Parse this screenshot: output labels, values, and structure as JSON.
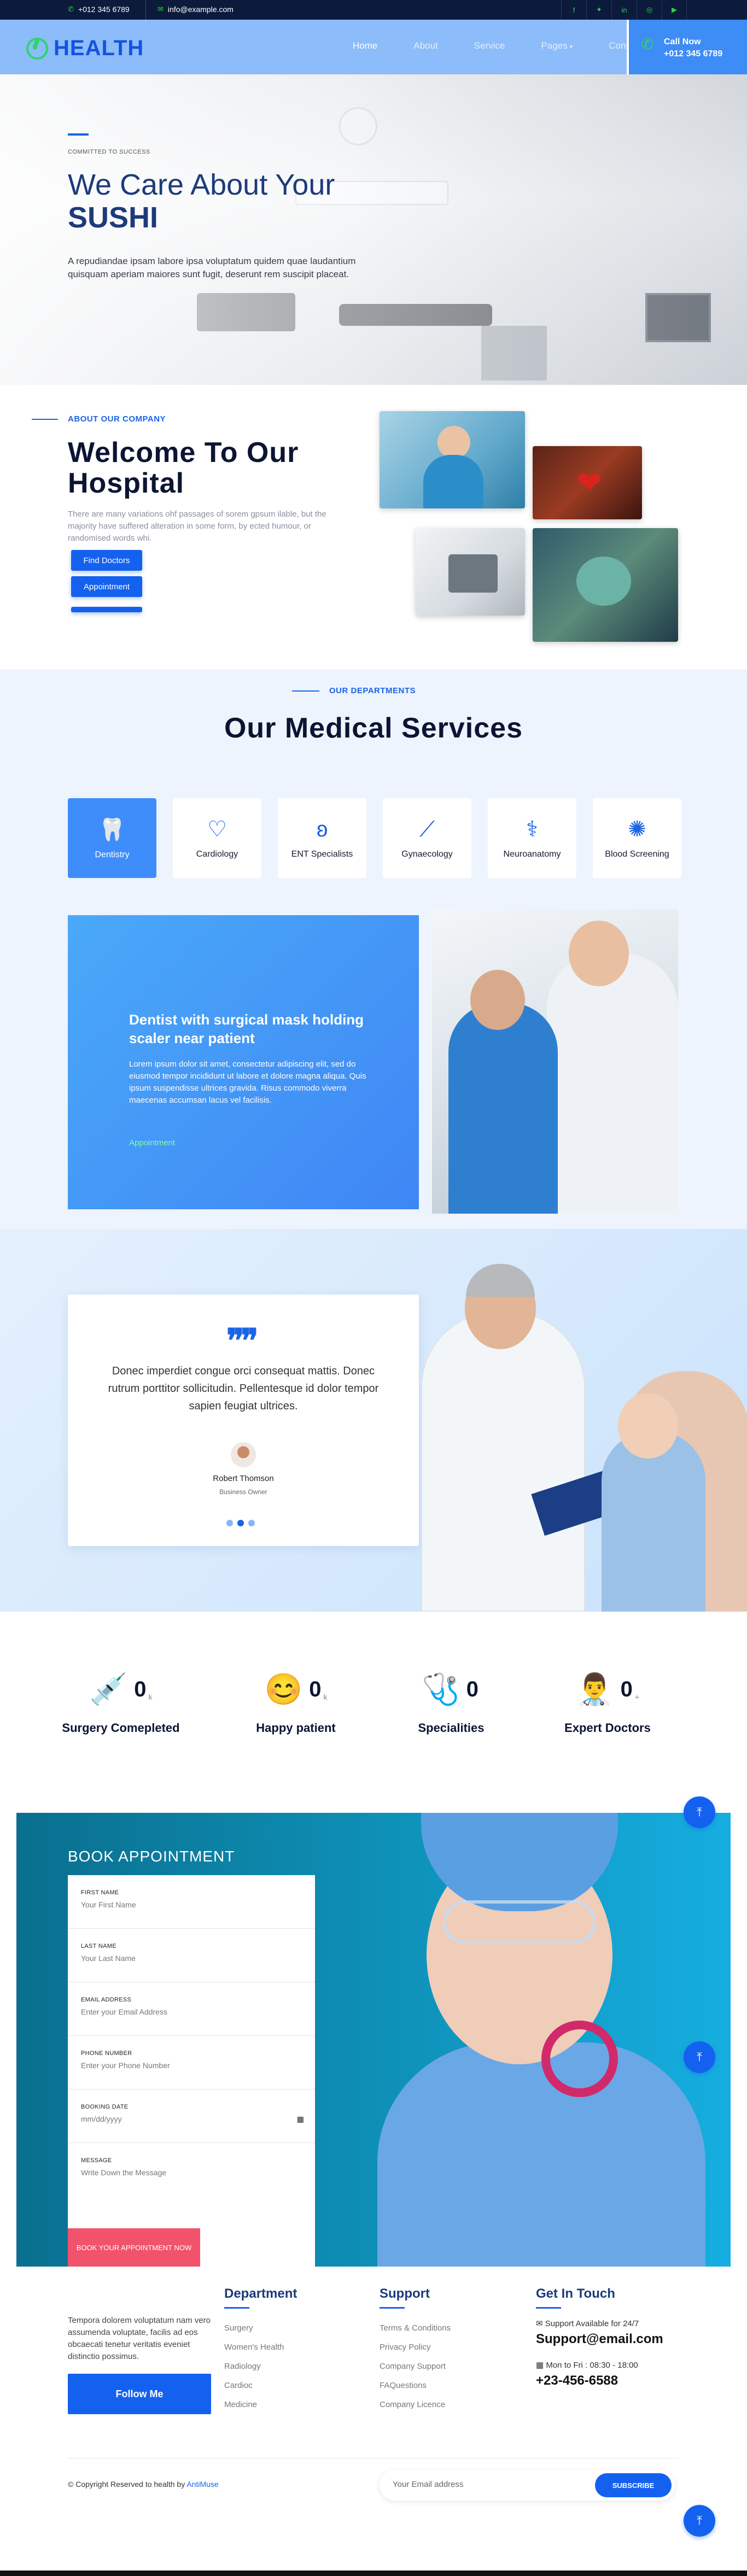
{
  "topbar": {
    "phone": "+012 345 6789",
    "email": "info@example.com",
    "social_icons": [
      "facebook-icon",
      "twitter-icon",
      "linkedin-icon",
      "instagram-icon",
      "youtube-icon"
    ]
  },
  "navbar": {
    "brand": "HEALTH",
    "links": [
      "Home",
      "About",
      "Service",
      "Pages",
      "Contact"
    ],
    "active": "Home",
    "call_label": "Call Now",
    "call_number": "+012 345 6789"
  },
  "hero": {
    "kicker": "COMMITTED TO SUCCESS",
    "title": "We Care About Your",
    "title_bold": "SUSHI",
    "description": "A repudiandae ipsam labore ipsa voluptatum quidem quae laudantium quisquam aperiam maiores sunt fugit, deserunt rem suscipit placeat."
  },
  "about": {
    "kicker": "ABOUT OUR COMPANY",
    "title": "Welcome To Our Hospital",
    "text": "There are many variations ohf passages of sorem gpsum ilable, but the majority have suffered alteration in some form, by ected humour, or randomised words whi.",
    "find_doctors": "Find Doctors",
    "appointment": "Appointment"
  },
  "services": {
    "kicker": "OUR DEPARTMENTS",
    "title": "Our Medical Services",
    "tabs": [
      {
        "label": "Dentistry",
        "icon": "tooth-icon"
      },
      {
        "label": "Cardiology",
        "icon": "heart-icon"
      },
      {
        "label": "ENT Specialists",
        "icon": "ear-icon"
      },
      {
        "label": "Gynaecology",
        "icon": "syringe-icon"
      },
      {
        "label": "Neuroanatomy",
        "icon": "lungs-icon"
      },
      {
        "label": "Blood Screening",
        "icon": "virus-icon"
      }
    ],
    "active_tab": "Dentistry",
    "card_title": "Dentist with surgical mask holding scaler near patient",
    "card_text": "Lorem ipsum dolor sit amet, consectetur adipiscing elit, sed do eiusmod tempor incididunt ut labore et dolore magna aliqua. Quis ipsum suspendisse ultrices gravida. Risus commodo viverra maecenas accumsan lacus vel facilisis.",
    "card_link": "Appointment"
  },
  "testimonial": {
    "quote": "Donec imperdiet congue orci consequat mattis. Donec rutrum porttitor sollicitudin. Pellentesque id dolor tempor sapien feugiat ultrices.",
    "name": "Robert Thomson",
    "role": "Business Owner",
    "slides": 3,
    "active_slide": 2
  },
  "counters": [
    {
      "value": "0",
      "unit": "k",
      "label": "Surgery Comepleted",
      "icon": "drip-icon"
    },
    {
      "value": "0",
      "unit": "k",
      "label": "Happy patient",
      "icon": "happy-face-icon"
    },
    {
      "value": "0",
      "unit": "",
      "label": "Specialities",
      "icon": "stethoscope-icon"
    },
    {
      "value": "0",
      "unit": "+",
      "label": "Expert Doctors",
      "icon": "doctor-icon"
    }
  ],
  "booking": {
    "title": "BOOK APPOINTMENT",
    "fields": [
      {
        "label": "FIRST NAME",
        "placeholder": "Your First Name"
      },
      {
        "label": "LAST NAME",
        "placeholder": "Your Last Name"
      },
      {
        "label": "EMAIL ADDRESS",
        "placeholder": "Enter your Email Address"
      },
      {
        "label": "PHONE NUMBER",
        "placeholder": "Enter your Phone Number"
      },
      {
        "label": "BOOKING DATE",
        "placeholder": "mm/dd/yyyy"
      },
      {
        "label": "MESSAGE",
        "placeholder": "Write Down the Message"
      }
    ],
    "submit": "BOOK YOUR APPOINTMENT NOW"
  },
  "footer": {
    "about_text": "Tempora dolorem voluptatum nam vero assumenda voluptate, facilis ad eos obcaecati tenetur veritatis eveniet distinctio possimus.",
    "follow": "Follow Me",
    "department_title": "Department",
    "departments": [
      "Surgery",
      "Women's Health",
      "Radiology",
      "Cardioc",
      "Medicine"
    ],
    "support_title": "Support",
    "support_links": [
      "Terms & Conditions",
      "Privacy Policy",
      "Company Support",
      "FAQuestions",
      "Company Licence"
    ],
    "contact_title": "Get In Touch",
    "support_available": "Support Available for 24/7",
    "support_email": "Support@email.com",
    "hours": "Mon to Fri : 08:30 - 18:00",
    "phone": "+23-456-6588",
    "copyright": "© Copyright Reserved to health by",
    "copyright_brand": "AntiMuse",
    "subscribe_placeholder": "Your Email address",
    "subscribe_button": "SUBSCRIBE"
  },
  "colors": {
    "accent": "#1461f0",
    "nav_bg": "#8cbcfa",
    "topbar_bg": "#0c1a3c",
    "green": "#2bd44b",
    "pink_button": "#f0536b"
  }
}
